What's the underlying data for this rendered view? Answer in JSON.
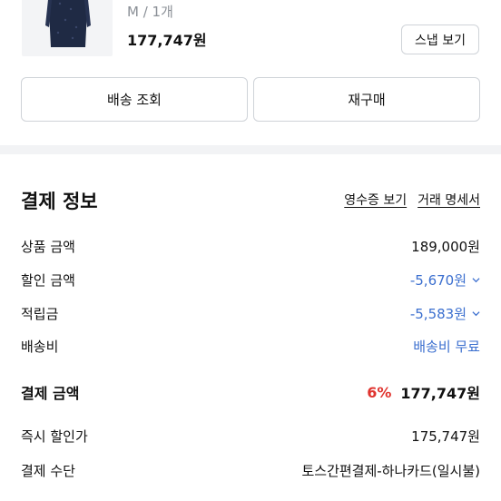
{
  "product": {
    "option": "M / 1개",
    "price": "177,747원",
    "snap_button": "스냅 보기"
  },
  "actions": {
    "delivery_lookup": "배송 조회",
    "repurchase": "재구매"
  },
  "payment": {
    "title": "결제 정보",
    "receipt_link": "영수증 보기",
    "statement_link": "거래 명세서",
    "rows": [
      {
        "label": "상품 금액",
        "value": "189,000원"
      },
      {
        "label": "할인 금액",
        "value": "-5,670원"
      },
      {
        "label": "적립금",
        "value": "-5,583원"
      },
      {
        "label": "배송비",
        "value": "배송비 무료"
      }
    ],
    "total": {
      "label": "결제 금액",
      "percent": "6%",
      "value": "177,747원"
    },
    "instant": {
      "label": "즉시 할인가",
      "value": "175,747원"
    },
    "method": {
      "label": "결제 수단",
      "value": "토스간편결제-하나카드(일시불)"
    }
  },
  "colors": {
    "accent_blue": "#3b6fcf",
    "discount_red": "#e0342f"
  }
}
